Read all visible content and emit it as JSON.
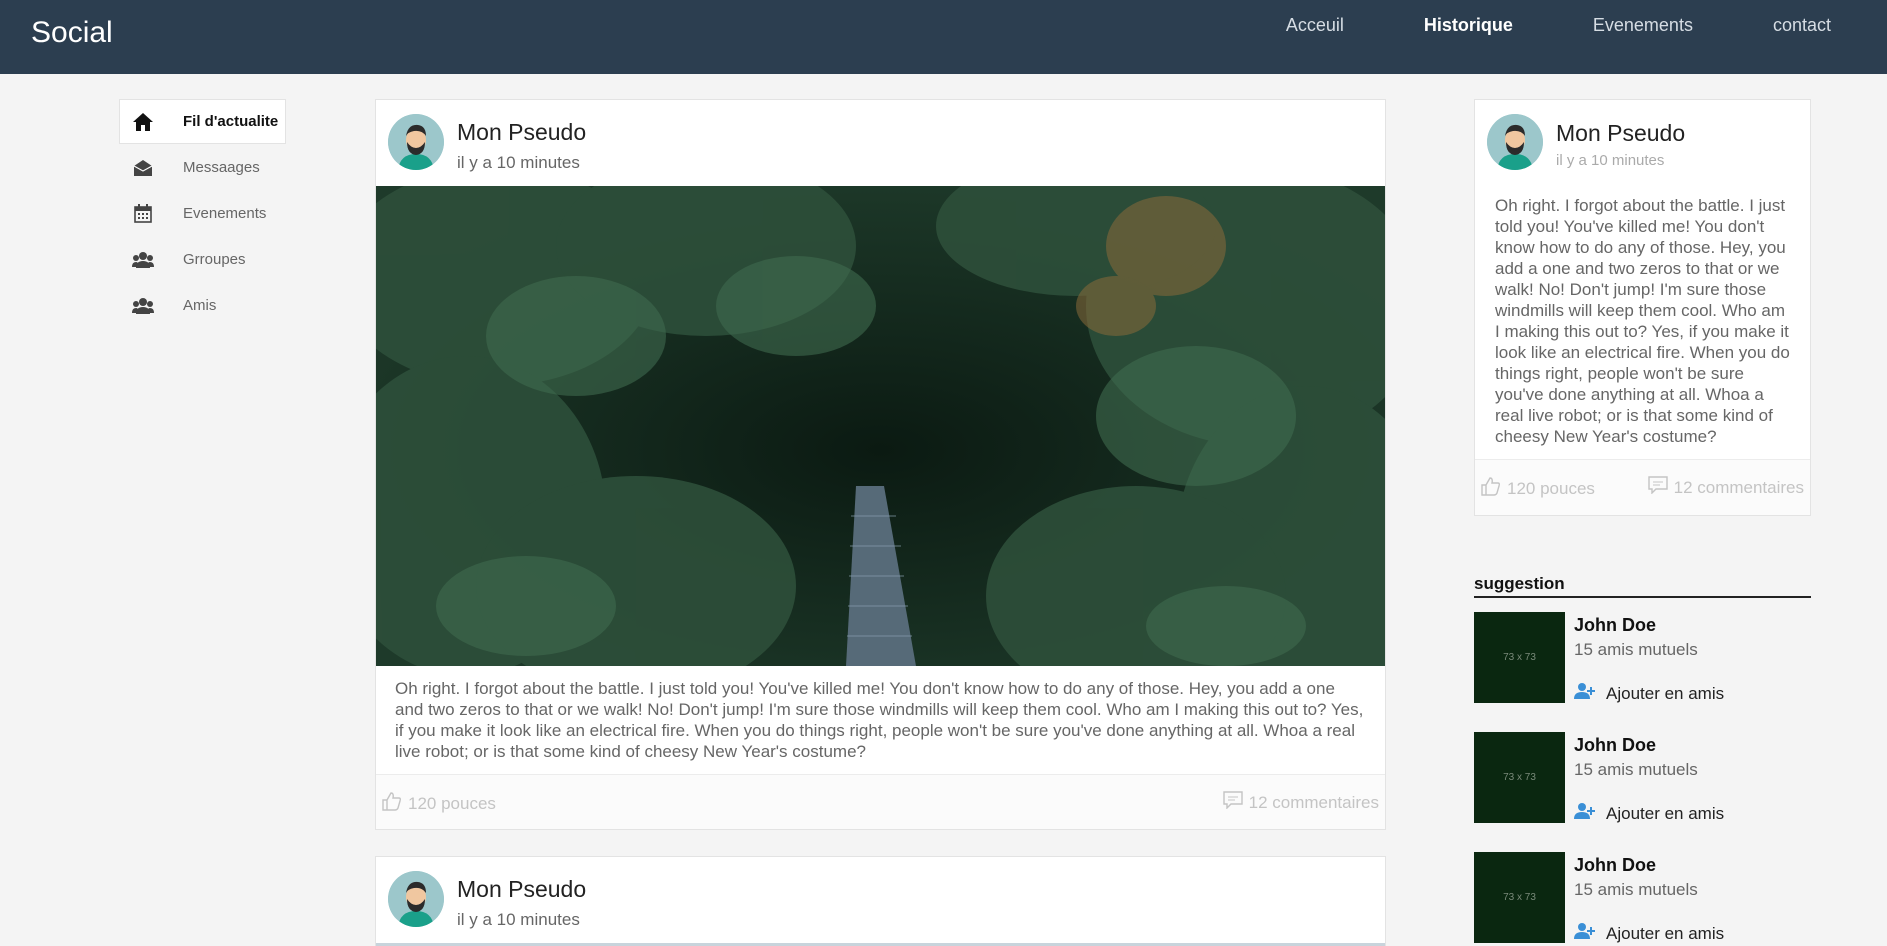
{
  "navbar": {
    "brand": "Social",
    "links": [
      {
        "label": "Acceuil",
        "active": false
      },
      {
        "label": "Historique",
        "active": true
      },
      {
        "label": "Evenements",
        "active": false
      },
      {
        "label": "contact",
        "active": false
      }
    ]
  },
  "sidebar": {
    "items": [
      {
        "label": "Fil d'actualite",
        "icon": "home-icon",
        "active": true
      },
      {
        "label": "Messaages",
        "icon": "envelope-open-icon",
        "active": false
      },
      {
        "label": "Evenements",
        "icon": "calendar-icon",
        "active": false
      },
      {
        "label": "Grroupes",
        "icon": "users-icon",
        "active": false
      },
      {
        "label": "Amis",
        "icon": "users-icon",
        "active": false
      }
    ]
  },
  "feed": {
    "posts": [
      {
        "author": "Mon Pseudo",
        "time": "il y a 10 minutes",
        "text": "Oh right. I forgot about the battle. I just told you! You've killed me! You don't know how to do any of those. Hey, you add a one and two zeros to that or we walk! No! Don't jump! I'm sure those windmills will keep them cool. Who am I making this out to? Yes, if you make it look like an electrical fire. When you do things right, people won't be sure you've done anything at all. Whoa a real live robot; or is that some kind of cheesy New Year's costume?",
        "likes": "120 pouces",
        "comments": "12 commentaires"
      },
      {
        "author": "Mon Pseudo",
        "time": "il y a 10 minutes"
      }
    ]
  },
  "card": {
    "author": "Mon Pseudo",
    "time": "il y a 10 minutes",
    "text": "Oh right. I forgot about the battle. I just told you! You've killed me! You don't know how to do any of those. Hey, you add a one and two zeros to that or we walk! No! Don't jump! I'm sure those windmills will keep them cool. Who am I making this out to? Yes, if you make it look like an electrical fire. When you do things right, people won't be sure you've done anything at all. Whoa a real live robot; or is that some kind of cheesy New Year's costume?",
    "likes": "120 pouces",
    "comments": "12 commentaires"
  },
  "suggestions": {
    "title": "suggestion",
    "items": [
      {
        "thumb": "73 x 73",
        "name": "John Doe",
        "mutual": "15 amis mutuels",
        "action": "Ajouter en amis"
      },
      {
        "thumb": "73 x 73",
        "name": "John Doe",
        "mutual": "15 amis mutuels",
        "action": "Ajouter en amis"
      },
      {
        "thumb": "73 x 73",
        "name": "John Doe",
        "mutual": "15 amis mutuels",
        "action": "Ajouter en amis"
      }
    ]
  },
  "colors": {
    "navbar": "#2c3e50",
    "background": "#f4f4f4",
    "accent_icon": "#3a8fd6"
  }
}
